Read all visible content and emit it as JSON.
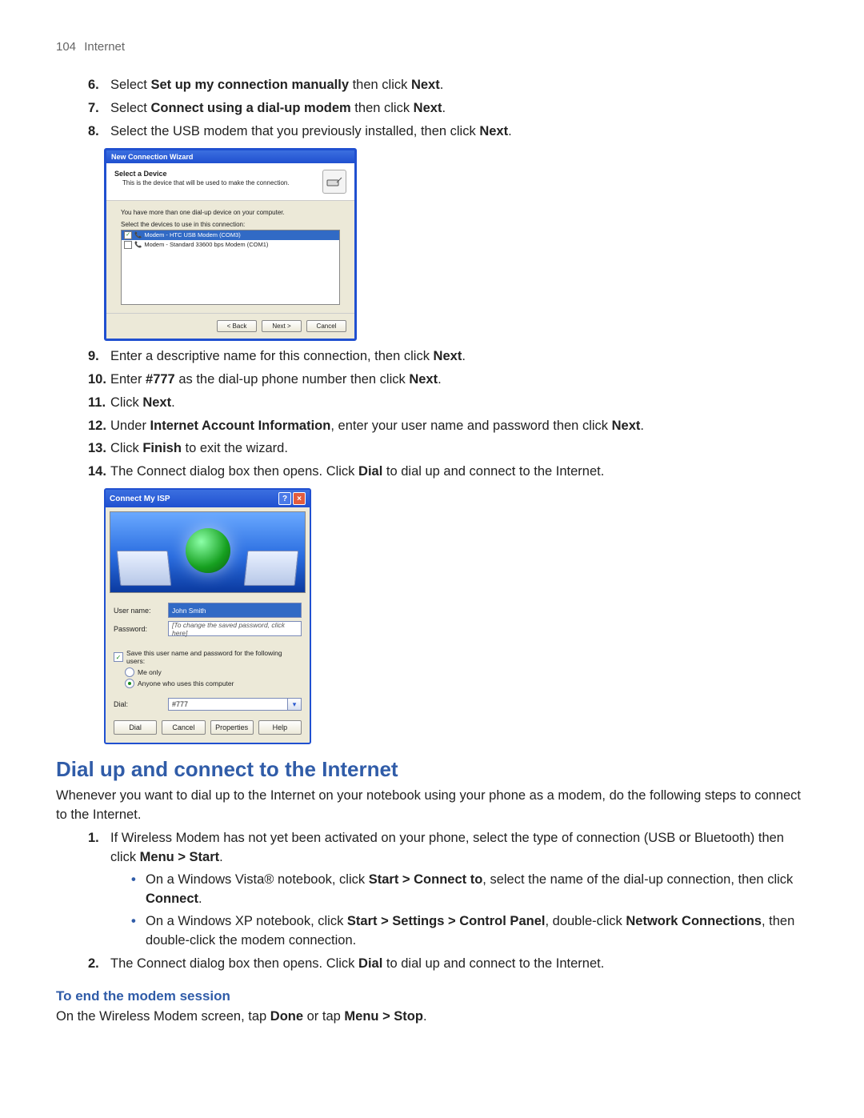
{
  "header": {
    "page_number": "104",
    "section": "Internet"
  },
  "steps_a": [
    {
      "n": "6.",
      "pre": "Select ",
      "b1": "Set up my connection manually",
      "mid": " then click ",
      "b2": "Next",
      "post": "."
    },
    {
      "n": "7.",
      "pre": "Select ",
      "b1": "Connect using a dial-up modem",
      "mid": " then click ",
      "b2": "Next",
      "post": "."
    },
    {
      "n": "8.",
      "pre": "Select the USB modem that you previously installed, then click ",
      "b1": "Next",
      "mid": "",
      "b2": "",
      "post": "."
    }
  ],
  "wizard": {
    "title": "New Connection Wizard",
    "heading": "Select a Device",
    "subheading": "This is the device that will be used to make the connection.",
    "intro": "You have more than one dial-up device on your computer.",
    "list_label": "Select the devices to use in this connection:",
    "devices": [
      {
        "checked": true,
        "selected": true,
        "label": "Modem - HTC USB Modem (COM3)"
      },
      {
        "checked": false,
        "selected": false,
        "label": "Modem - Standard 33600 bps Modem (COM1)"
      }
    ],
    "buttons": {
      "back": "< Back",
      "next": "Next >",
      "cancel": "Cancel"
    }
  },
  "steps_b": [
    {
      "n": "9.",
      "html": "Enter a descriptive name for this connection, then click <b>Next</b>."
    },
    {
      "n": "10.",
      "html": "Enter <b>#777</b> as the dial-up phone number then click <b>Next</b>."
    },
    {
      "n": "11.",
      "html": "Click <b>Next</b>."
    },
    {
      "n": "12.",
      "html": "Under <b>Internet Account Information</b>, enter your user name and password then click <b>Next</b>."
    },
    {
      "n": "13.",
      "html": "Click <b>Finish</b> to exit the wizard."
    },
    {
      "n": "14.",
      "html": "The Connect dialog box then opens. Click <b>Dial</b> to dial up and connect to the Internet."
    }
  ],
  "connect": {
    "title": "Connect My ISP",
    "username_label": "User name:",
    "username_value": "John Smith",
    "password_label": "Password:",
    "password_placeholder": "[To change the saved password, click here]",
    "save_label": "Save this user name and password for the following users:",
    "radio_me": "Me only",
    "radio_anyone": "Anyone who uses this computer",
    "radio_selected": "anyone",
    "dial_label": "Dial:",
    "dial_value": "#777",
    "buttons": {
      "dial": "Dial",
      "cancel": "Cancel",
      "properties": "Properties",
      "help": "Help"
    }
  },
  "section2": {
    "heading": "Dial up and connect to the Internet",
    "intro": "Whenever you want to dial up to the Internet on your notebook using your phone as a modem, do the following steps to connect to the Internet.",
    "steps": [
      {
        "n": "1.",
        "html": "If Wireless Modem has not yet been activated on your phone, select the type of connection (USB or Bluetooth) then click <b>Menu > Start</b>.",
        "bullets": [
          "On a Windows Vista® notebook, click <b>Start > Connect to</b>, select the name of the dial-up connection, then click <b>Connect</b>.",
          "On a Windows XP notebook, click <b>Start > Settings > Control Panel</b>, double-click <b>Network Connections</b>, then double-click the modem connection."
        ]
      },
      {
        "n": "2.",
        "html": "The Connect dialog box then opens. Click <b>Dial</b> to dial up and connect to the Internet."
      }
    ],
    "sub_heading": "To end the modem session",
    "sub_body": "On the Wireless Modem screen, tap <b>Done</b> or tap <b>Menu > Stop</b>."
  }
}
